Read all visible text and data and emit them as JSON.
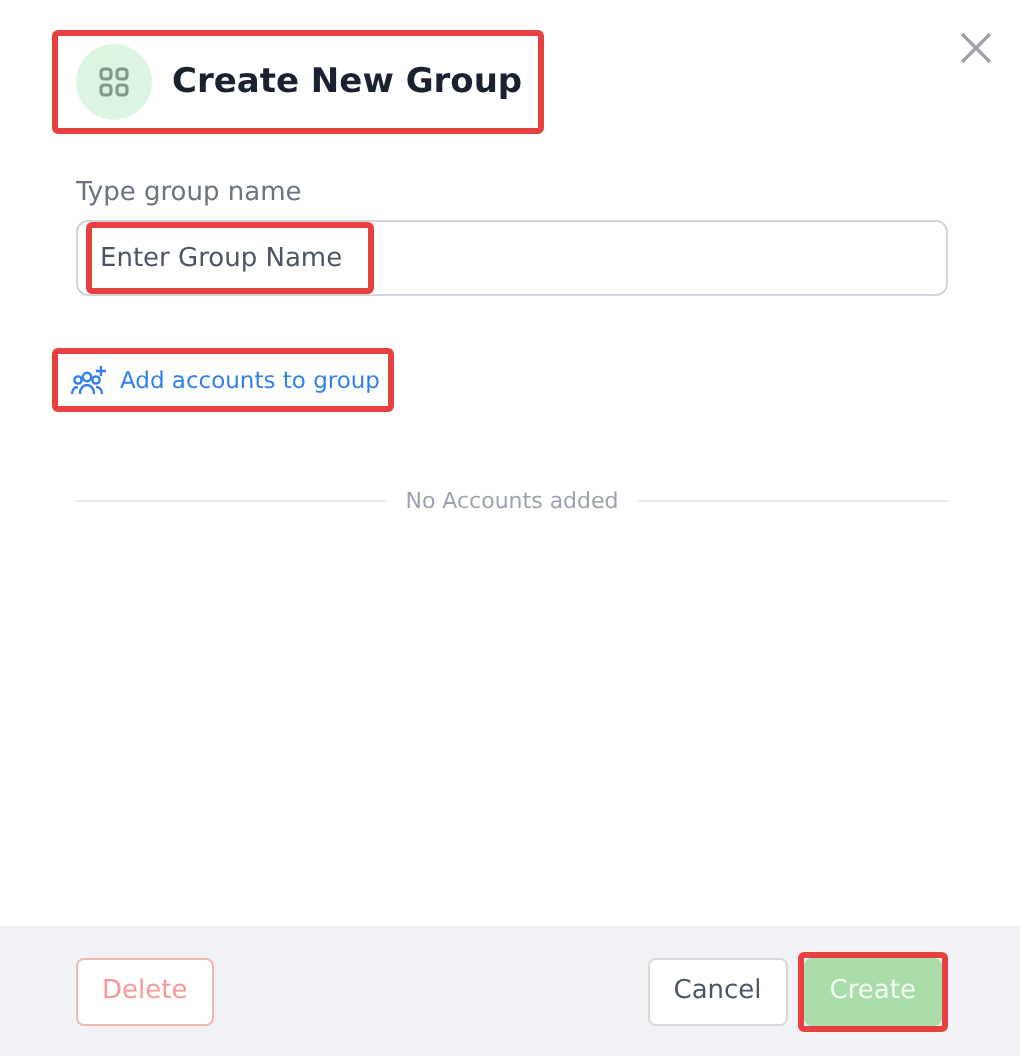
{
  "dialog": {
    "title": "Create New Group",
    "title_highlighted": true
  },
  "name_field": {
    "label": "Type group name",
    "placeholder": "Enter Group Name",
    "highlighted": true
  },
  "add_accounts_link": {
    "label": "Add accounts to group",
    "highlighted": true
  },
  "empty_message": "No Accounts added",
  "footer_buttons": [
    {
      "kind": "danger",
      "label": "Delete",
      "disabled": true,
      "highlighted": false
    },
    {
      "kind": "secondary",
      "label": "Cancel",
      "disabled": false,
      "highlighted": false
    },
    {
      "kind": "primary",
      "label": "Create",
      "disabled": true,
      "highlighted": true
    }
  ]
}
